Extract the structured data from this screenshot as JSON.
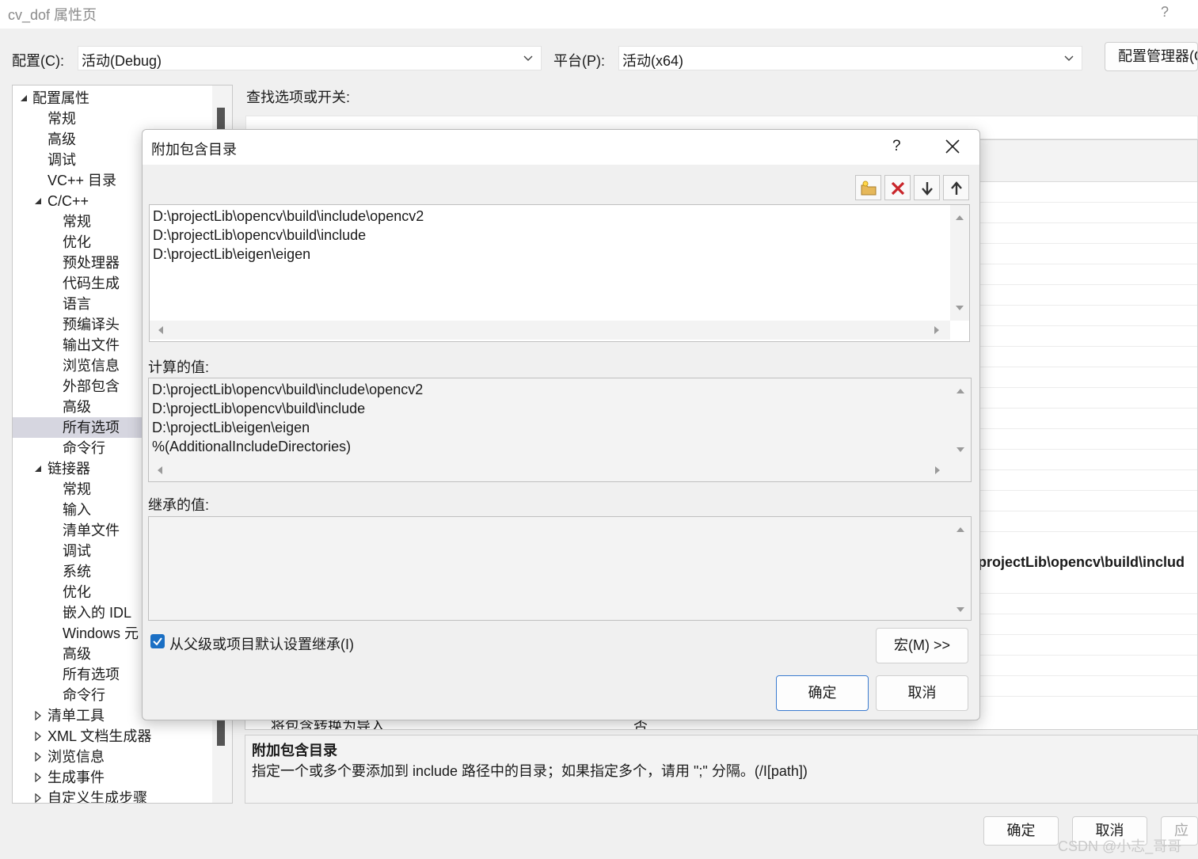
{
  "window": {
    "title": "cv_dof 属性页",
    "help": "?"
  },
  "config": {
    "config_label": "配置(C):",
    "config_value": "活动(Debug)",
    "platform_label": "平台(P):",
    "platform_value": "活动(x64)",
    "manager_button": "配置管理器(O"
  },
  "tree": {
    "items": [
      {
        "label": "配置属性"
      },
      {
        "label": "常规"
      },
      {
        "label": "高级"
      },
      {
        "label": "调试"
      },
      {
        "label": "VC++ 目录"
      },
      {
        "label": "C/C++"
      },
      {
        "label": "常规"
      },
      {
        "label": "优化"
      },
      {
        "label": "预处理器"
      },
      {
        "label": "代码生成"
      },
      {
        "label": "语言"
      },
      {
        "label": "预编译头"
      },
      {
        "label": "输出文件"
      },
      {
        "label": "浏览信息"
      },
      {
        "label": "外部包含"
      },
      {
        "label": "高级"
      },
      {
        "label": "所有选项"
      },
      {
        "label": "命令行"
      },
      {
        "label": "链接器"
      },
      {
        "label": "常规"
      },
      {
        "label": "输入"
      },
      {
        "label": "清单文件"
      },
      {
        "label": "调试"
      },
      {
        "label": "系统"
      },
      {
        "label": "优化"
      },
      {
        "label": "嵌入的 IDL"
      },
      {
        "label": "Windows 元"
      },
      {
        "label": "高级"
      },
      {
        "label": "所有选项"
      },
      {
        "label": "命令行"
      },
      {
        "label": "清单工具"
      },
      {
        "label": "XML 文档生成器"
      },
      {
        "label": "浏览信息"
      },
      {
        "label": "生成事件"
      },
      {
        "label": "自定义生成步骤"
      }
    ]
  },
  "main": {
    "search_label": "查找选项或开关:",
    "visible_value": "projectLib\\opencv\\build\\includ",
    "partial_row_name": "将包含转换为导入",
    "partial_row_value": "否",
    "desc_title": "附加包含目录",
    "desc_text": "指定一个或多个要添加到 include 路径中的目录；如果指定多个，请用 \";\" 分隔。(/I[path])"
  },
  "footer": {
    "ok": "确定",
    "cancel": "取消",
    "apply": "应用",
    "watermark": "CSDN @小志_哥哥"
  },
  "dialog": {
    "title": "附加包含目录",
    "help": "?",
    "edit_lines": [
      "D:\\projectLib\\opencv\\build\\include\\opencv2",
      "D:\\projectLib\\opencv\\build\\include",
      "D:\\projectLib\\eigen\\eigen"
    ],
    "evaluated_label": "计算的值:",
    "evaluated_lines": [
      "D:\\projectLib\\opencv\\build\\include\\opencv2",
      "D:\\projectLib\\opencv\\build\\include",
      "D:\\projectLib\\eigen\\eigen",
      "%(AdditionalIncludeDirectories)"
    ],
    "inherited_label": "继承的值:",
    "inherit_checkbox_label": "从父级或项目默认设置继承(I)",
    "inherit_checked": true,
    "macros_button": "宏(M) >>",
    "ok": "确定",
    "cancel": "取消",
    "toolbar_icons": [
      "new-folder-icon",
      "delete-icon",
      "move-down-icon",
      "move-up-icon"
    ]
  }
}
